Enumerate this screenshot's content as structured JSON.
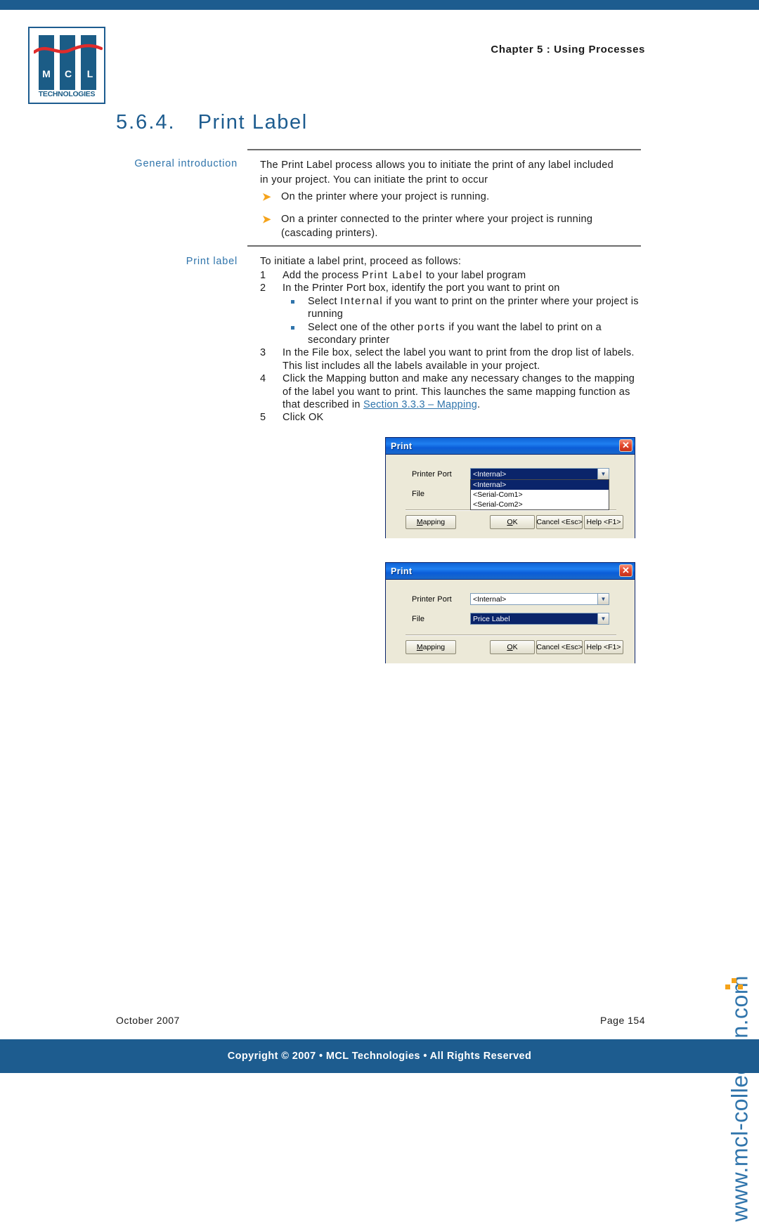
{
  "header": {
    "chapter": "Chapter 5 : Using Processes",
    "logo": {
      "letters": [
        "M",
        "C",
        "L"
      ],
      "wordmark": "TECHNOLOGIES"
    }
  },
  "title": {
    "number": "5.6.4.",
    "text": "Print Label"
  },
  "sections": [
    {
      "label": "General introduction",
      "paragraph": "The Print Label process allows you to initiate the print of any label included in your project. You can initiate the print to occur",
      "bullets": [
        "On the printer where your project is running.",
        "On a printer connected to the printer where your project is running (cascading printers)."
      ]
    }
  ],
  "print_label": {
    "label": "Print label",
    "intro": "To initiate a label print, proceed as follows:",
    "steps": [
      {
        "n": "1",
        "text_a": "Add the process ",
        "emph": "Print Label",
        "text_b": " to your label program"
      },
      {
        "n": "2",
        "text_a": "In the Printer Port box, identify the port you want to print on",
        "emph": "",
        "text_b": ""
      },
      {
        "n": "3",
        "text_a": "In the File box, select the label you want to print from the drop list of labels. This list includes all the labels available in your project.",
        "emph": "",
        "text_b": ""
      },
      {
        "n": "4",
        "text_a": "Click the Mapping button and make any necessary changes to the mapping of the label you want to print. This launches the same mapping function as that described in ",
        "emph": "",
        "text_b": ""
      },
      {
        "n": "5",
        "text_a": "Click OK",
        "emph": "",
        "text_b": ""
      }
    ],
    "sub_bullets": [
      {
        "pre": "Select ",
        "emph": "Internal",
        "post": " if you want to print on the printer where your project is running"
      },
      {
        "pre": "Select one of the other ",
        "emph": "ports",
        "post": " if you want the label to print on a secondary printer"
      }
    ],
    "link_text": "Section 3.3.3 – Mapping",
    "link_suffix": "."
  },
  "dialogs": [
    {
      "title": "Print",
      "close_glyph": "✕",
      "fields": [
        {
          "label": "Printer Port",
          "value": "<Internal>",
          "state": "open"
        },
        {
          "label": "File",
          "value": "",
          "state": "normal"
        }
      ],
      "dropdown_options": [
        "<Internal>",
        "<Serial-Com1>",
        "<Serial-Com2>"
      ],
      "dropdown_selected": "<Internal>",
      "buttons": [
        {
          "name": "mapping",
          "pre": "",
          "accel": "M",
          "post": "apping"
        },
        {
          "name": "ok",
          "pre": "",
          "accel": "O",
          "post": "K"
        },
        {
          "name": "cancel",
          "pre": "Cancel <E",
          "accel": "",
          "post": "sc>"
        },
        {
          "name": "help",
          "pre": "Help <F1>",
          "accel": "",
          "post": ""
        }
      ]
    },
    {
      "title": "Print",
      "close_glyph": "✕",
      "fields": [
        {
          "label": "Printer Port",
          "value": "<Internal>",
          "state": "normal"
        },
        {
          "label": "File",
          "value": "Price Label",
          "state": "selected"
        }
      ],
      "buttons": [
        {
          "name": "mapping",
          "pre": "",
          "accel": "M",
          "post": "apping"
        },
        {
          "name": "ok",
          "pre": "",
          "accel": "O",
          "post": "K"
        },
        {
          "name": "cancel",
          "pre": "Cancel <E",
          "accel": "",
          "post": "sc>"
        },
        {
          "name": "help",
          "pre": "Help <F1>",
          "accel": "",
          "post": ""
        }
      ]
    }
  ],
  "watermark": {
    "text": "www.mcl-collection.com"
  },
  "footer": {
    "date": "October 2007",
    "page": "Page  154",
    "copyright": "Copyright © 2007 • MCL Technologies • All Rights Reserved"
  },
  "colors": {
    "brand_blue": "#1d5c8f",
    "link_blue": "#2f74ab",
    "bullet_orange": "#f5a31a",
    "dialog_title": "#0f62d6"
  }
}
